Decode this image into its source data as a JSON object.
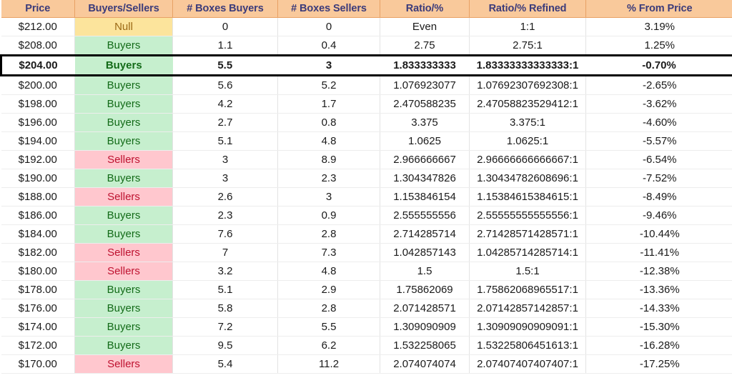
{
  "table": {
    "columns": [
      "Price",
      "Buyers/Sellers",
      "# Boxes Buyers",
      "# Boxes Sellers",
      "Ratio/%",
      "Ratio/% Refined",
      "% From Price"
    ],
    "highlighted_row_index": 2,
    "colors": {
      "header_background": "#F9C99B",
      "header_text": "#3B3B7A",
      "buyers_background": "#C6EFCE",
      "buyers_text": "#136B18",
      "sellers_background": "#FFC7CE",
      "sellers_text": "#BE1230",
      "null_background": "#FCE49C",
      "null_text": "#9C6A16",
      "highlight_border": "#000000"
    },
    "rows": [
      {
        "price": "$212.00",
        "side": "Null",
        "side_kind": "null",
        "boxes_buyers": "0",
        "boxes_sellers": "0",
        "ratio": "Even",
        "ratio_refined": "1:1",
        "pct_from_price": "3.19%"
      },
      {
        "price": "$208.00",
        "side": "Buyers",
        "side_kind": "buyers",
        "boxes_buyers": "1.1",
        "boxes_sellers": "0.4",
        "ratio": "2.75",
        "ratio_refined": "2.75:1",
        "pct_from_price": "1.25%"
      },
      {
        "price": "$204.00",
        "side": "Buyers",
        "side_kind": "buyers",
        "boxes_buyers": "5.5",
        "boxes_sellers": "3",
        "ratio": "1.833333333",
        "ratio_refined": "1.83333333333333:1",
        "pct_from_price": "-0.70%"
      },
      {
        "price": "$200.00",
        "side": "Buyers",
        "side_kind": "buyers",
        "boxes_buyers": "5.6",
        "boxes_sellers": "5.2",
        "ratio": "1.076923077",
        "ratio_refined": "1.07692307692308:1",
        "pct_from_price": "-2.65%"
      },
      {
        "price": "$198.00",
        "side": "Buyers",
        "side_kind": "buyers",
        "boxes_buyers": "4.2",
        "boxes_sellers": "1.7",
        "ratio": "2.470588235",
        "ratio_refined": "2.47058823529412:1",
        "pct_from_price": "-3.62%"
      },
      {
        "price": "$196.00",
        "side": "Buyers",
        "side_kind": "buyers",
        "boxes_buyers": "2.7",
        "boxes_sellers": "0.8",
        "ratio": "3.375",
        "ratio_refined": "3.375:1",
        "pct_from_price": "-4.60%"
      },
      {
        "price": "$194.00",
        "side": "Buyers",
        "side_kind": "buyers",
        "boxes_buyers": "5.1",
        "boxes_sellers": "4.8",
        "ratio": "1.0625",
        "ratio_refined": "1.0625:1",
        "pct_from_price": "-5.57%"
      },
      {
        "price": "$192.00",
        "side": "Sellers",
        "side_kind": "sellers",
        "boxes_buyers": "3",
        "boxes_sellers": "8.9",
        "ratio": "2.966666667",
        "ratio_refined": "2.96666666666667:1",
        "pct_from_price": "-6.54%"
      },
      {
        "price": "$190.00",
        "side": "Buyers",
        "side_kind": "buyers",
        "boxes_buyers": "3",
        "boxes_sellers": "2.3",
        "ratio": "1.304347826",
        "ratio_refined": "1.30434782608696:1",
        "pct_from_price": "-7.52%"
      },
      {
        "price": "$188.00",
        "side": "Sellers",
        "side_kind": "sellers",
        "boxes_buyers": "2.6",
        "boxes_sellers": "3",
        "ratio": "1.153846154",
        "ratio_refined": "1.15384615384615:1",
        "pct_from_price": "-8.49%"
      },
      {
        "price": "$186.00",
        "side": "Buyers",
        "side_kind": "buyers",
        "boxes_buyers": "2.3",
        "boxes_sellers": "0.9",
        "ratio": "2.555555556",
        "ratio_refined": "2.55555555555556:1",
        "pct_from_price": "-9.46%"
      },
      {
        "price": "$184.00",
        "side": "Buyers",
        "side_kind": "buyers",
        "boxes_buyers": "7.6",
        "boxes_sellers": "2.8",
        "ratio": "2.714285714",
        "ratio_refined": "2.71428571428571:1",
        "pct_from_price": "-10.44%"
      },
      {
        "price": "$182.00",
        "side": "Sellers",
        "side_kind": "sellers",
        "boxes_buyers": "7",
        "boxes_sellers": "7.3",
        "ratio": "1.042857143",
        "ratio_refined": "1.04285714285714:1",
        "pct_from_price": "-11.41%"
      },
      {
        "price": "$180.00",
        "side": "Sellers",
        "side_kind": "sellers",
        "boxes_buyers": "3.2",
        "boxes_sellers": "4.8",
        "ratio": "1.5",
        "ratio_refined": "1.5:1",
        "pct_from_price": "-12.38%"
      },
      {
        "price": "$178.00",
        "side": "Buyers",
        "side_kind": "buyers",
        "boxes_buyers": "5.1",
        "boxes_sellers": "2.9",
        "ratio": "1.75862069",
        "ratio_refined": "1.75862068965517:1",
        "pct_from_price": "-13.36%"
      },
      {
        "price": "$176.00",
        "side": "Buyers",
        "side_kind": "buyers",
        "boxes_buyers": "5.8",
        "boxes_sellers": "2.8",
        "ratio": "2.071428571",
        "ratio_refined": "2.07142857142857:1",
        "pct_from_price": "-14.33%"
      },
      {
        "price": "$174.00",
        "side": "Buyers",
        "side_kind": "buyers",
        "boxes_buyers": "7.2",
        "boxes_sellers": "5.5",
        "ratio": "1.309090909",
        "ratio_refined": "1.30909090909091:1",
        "pct_from_price": "-15.30%"
      },
      {
        "price": "$172.00",
        "side": "Buyers",
        "side_kind": "buyers",
        "boxes_buyers": "9.5",
        "boxes_sellers": "6.2",
        "ratio": "1.532258065",
        "ratio_refined": "1.53225806451613:1",
        "pct_from_price": "-16.28%"
      },
      {
        "price": "$170.00",
        "side": "Sellers",
        "side_kind": "sellers",
        "boxes_buyers": "5.4",
        "boxes_sellers": "11.2",
        "ratio": "2.074074074",
        "ratio_refined": "2.07407407407407:1",
        "pct_from_price": "-17.25%"
      }
    ]
  }
}
